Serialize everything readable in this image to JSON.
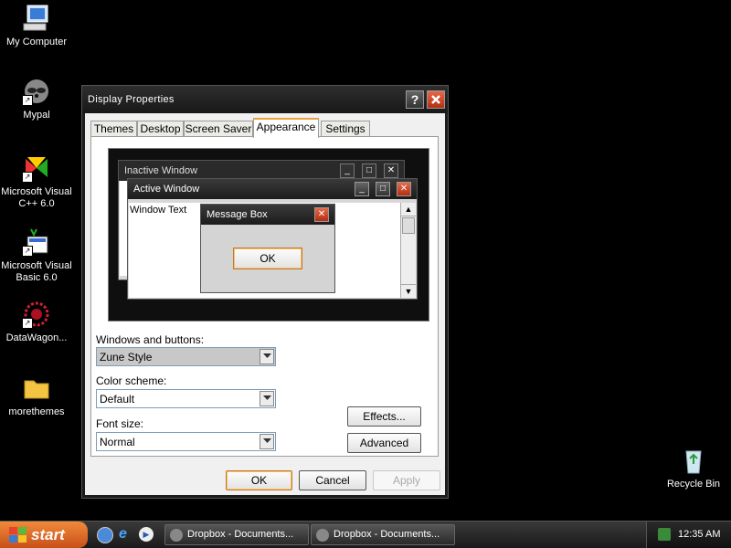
{
  "desktop": {
    "icons": [
      {
        "label": "My Computer",
        "icon": "computer-icon"
      },
      {
        "label": "Mypal",
        "icon": "mypal-raccoon-icon"
      },
      {
        "label": "Microsoft Visual C++ 6.0",
        "icon": "visual-cpp-icon"
      },
      {
        "label": "Microsoft Visual Basic 6.0",
        "icon": "visual-basic-icon"
      },
      {
        "label": "DataWagon...",
        "icon": "datawagon-icon"
      },
      {
        "label": "morethemes",
        "icon": "folder-icon"
      },
      {
        "label": "Recycle Bin",
        "icon": "recycle-bin-icon"
      }
    ]
  },
  "dialog": {
    "title": "Display Properties",
    "help_label": "?",
    "tabs": [
      "Themes",
      "Desktop",
      "Screen Saver",
      "Appearance",
      "Settings"
    ],
    "active_tab": "Appearance",
    "preview": {
      "inactive_window": "Inactive Window",
      "active_window": "Active Window",
      "window_text": "Window Text",
      "message_box": "Message Box",
      "ok": "OK"
    },
    "windows_and_buttons_label": "Windows and buttons:",
    "windows_and_buttons_value": "Zune Style",
    "color_scheme_label": "Color scheme:",
    "color_scheme_value": "Default",
    "font_size_label": "Font size:",
    "font_size_value": "Normal",
    "effects_button": "Effects...",
    "advanced_button": "Advanced",
    "ok_button": "OK",
    "cancel_button": "Cancel",
    "apply_button": "Apply"
  },
  "taskbar": {
    "start_label": "start",
    "items": [
      "Dropbox - Documents...",
      "Dropbox - Documents..."
    ],
    "clock": "12:35 AM"
  },
  "colors": {
    "start_button": "#d86a2a",
    "close_red": "#c9432a",
    "tab_highlight": "#e8a23a"
  }
}
